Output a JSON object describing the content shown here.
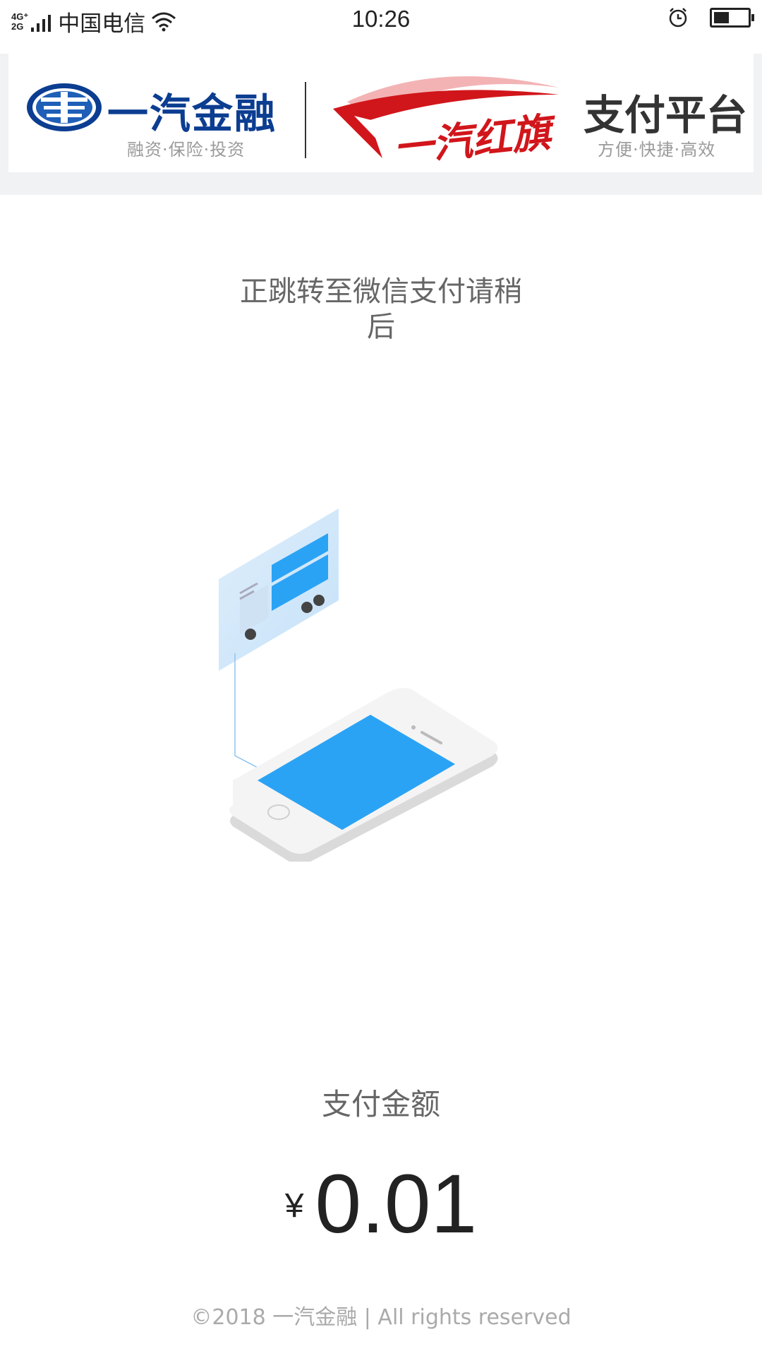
{
  "status_bar": {
    "network": "4G⁺\n2G",
    "carrier": "中国电信",
    "time": "10:26",
    "battery_level": 0.45
  },
  "header": {
    "brand_name": "一汽金融",
    "brand_sub": "融资·保险·投资",
    "hongqi_text": "一汽红旗",
    "platform_title": "支付平台",
    "platform_sub": "方便·快捷·高效"
  },
  "main": {
    "redirect_message": "正跳转至微信支付请稍后",
    "amount_label": "支付金额",
    "currency": "¥",
    "amount": "0.01"
  },
  "footer": {
    "text": "©2018 一汽金融 | All rights reserved"
  },
  "colors": {
    "brand_blue": "#0b3d91",
    "hongqi_red": "#d1161b",
    "screen_blue": "#2aa3f5"
  }
}
